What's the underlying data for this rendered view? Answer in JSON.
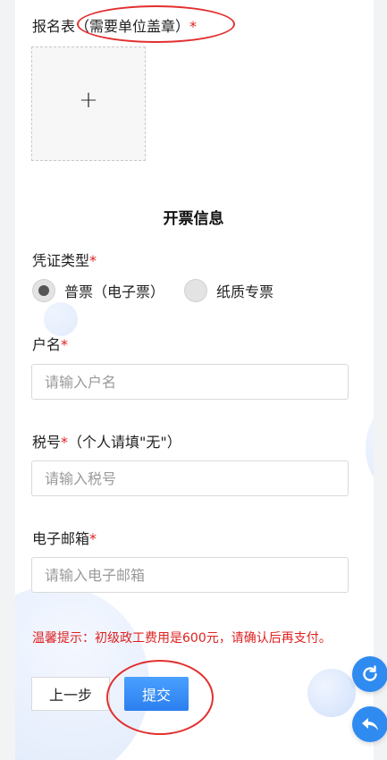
{
  "form": {
    "registration_label": "报名表",
    "registration_note": "（需要单位盖章）",
    "required_mark": "*",
    "upload_plus": "+"
  },
  "invoice": {
    "section_title": "开票信息",
    "voucher_type_label": "凭证类型",
    "voucher_options": [
      {
        "label": "普票（电子票）",
        "selected": true
      },
      {
        "label": "纸质专票",
        "selected": false
      }
    ],
    "account_name_label": "户名",
    "account_name_placeholder": "请输入户名",
    "tax_id_label": "税号",
    "tax_id_note": "（个人请填\"无\"）",
    "tax_id_placeholder": "请输入税号",
    "email_label": "电子邮箱",
    "email_placeholder": "请输入电子邮箱"
  },
  "tip": "温馨提示：初级政工费用是600元，请确认后再支付。",
  "buttons": {
    "prev": "上一步",
    "submit": "提交"
  },
  "colors": {
    "accent": "#2f8bf0",
    "required": "#e02020",
    "annotation": "#e23030"
  },
  "floating": {
    "refresh_icon": "refresh-icon",
    "back_icon": "back-arrow-icon"
  }
}
